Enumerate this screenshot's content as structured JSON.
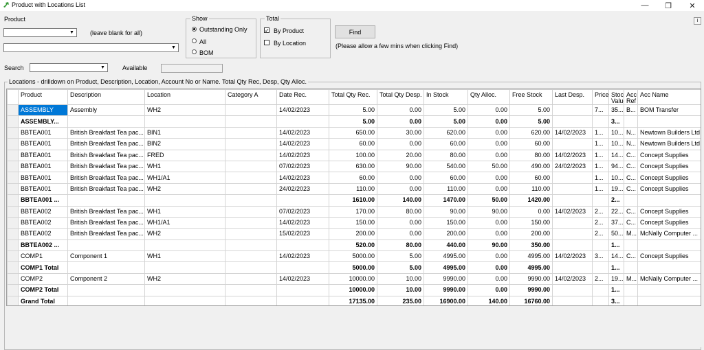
{
  "window": {
    "title": "Product with Locations List",
    "minimize": "—",
    "restore": "❐",
    "close": "✕"
  },
  "filters": {
    "product_label": "Product",
    "product_value": "",
    "blank_hint": "(leave blank for all)",
    "second_value": "",
    "search_label": "Search",
    "search_value": "",
    "available_label": "Available",
    "available_value": ""
  },
  "show": {
    "title": "Show",
    "options": [
      "Outstanding Only",
      "All",
      "BOM"
    ],
    "selected": "Outstanding Only"
  },
  "total": {
    "title": "Total",
    "by_product": "By Product",
    "by_product_checked": true,
    "by_location": "By Location",
    "by_location_checked": false
  },
  "find": {
    "label": "Find",
    "hint": "(Please allow a few mins when clicking Find)"
  },
  "help_label": "i",
  "locations_caption": "Locations - drilldown on Product, Description, Location, Account No or Name. Total Qty Rec, Desp, Qty Alloc.",
  "grid": {
    "columns": [
      "Product",
      "Description",
      "Location",
      "Category A",
      "Date Rec.",
      "Total Qty Rec.",
      "Total Qty Desp.",
      "In Stock",
      "Qty Alloc.",
      "Free Stock",
      "Last Desp.",
      "Price",
      "Stock Value",
      "Acc Ref",
      "Acc Name"
    ],
    "rows": [
      {
        "total": false,
        "cells": [
          "ASSEMBLY",
          "Assembly",
          "WH2",
          "",
          "14/02/2023",
          "5.00",
          "0.00",
          "5.00",
          "0.00",
          "5.00",
          "",
          "7...",
          "35...",
          "B...",
          "BOM Transfer"
        ]
      },
      {
        "total": true,
        "cells": [
          "ASSEMBLY...",
          "",
          "",
          "",
          "",
          "5.00",
          "0.00",
          "5.00",
          "0.00",
          "5.00",
          "",
          "",
          "3...",
          "",
          ""
        ]
      },
      {
        "total": false,
        "cells": [
          "BBTEA001",
          "British Breakfast  Tea pac...",
          "BIN1",
          "",
          "14/02/2023",
          "650.00",
          "30.00",
          "620.00",
          "0.00",
          "620.00",
          "14/02/2023",
          "1...",
          "10...",
          "N...",
          "Newtown Builders Ltd"
        ]
      },
      {
        "total": false,
        "cells": [
          "BBTEA001",
          "British Breakfast  Tea pac...",
          "BIN2",
          "",
          "14/02/2023",
          "60.00",
          "0.00",
          "60.00",
          "0.00",
          "60.00",
          "",
          "1...",
          "10...",
          "N...",
          "Newtown Builders Ltd"
        ]
      },
      {
        "total": false,
        "cells": [
          "BBTEA001",
          "British Breakfast  Tea pac...",
          "FRED",
          "",
          "14/02/2023",
          "100.00",
          "20.00",
          "80.00",
          "0.00",
          "80.00",
          "14/02/2023",
          "1...",
          "14...",
          "C...",
          "Concept Supplies"
        ]
      },
      {
        "total": false,
        "cells": [
          "BBTEA001",
          "British Breakfast  Tea pac...",
          "WH1",
          "",
          "07/02/2023",
          "630.00",
          "90.00",
          "540.00",
          "50.00",
          "490.00",
          "24/02/2023",
          "1...",
          "94...",
          "C...",
          "Concept Supplies"
        ]
      },
      {
        "total": false,
        "cells": [
          "BBTEA001",
          "British Breakfast  Tea pac...",
          "WH1/A1",
          "",
          "14/02/2023",
          "60.00",
          "0.00",
          "60.00",
          "0.00",
          "60.00",
          "",
          "1...",
          "10...",
          "C...",
          "Concept Supplies"
        ]
      },
      {
        "total": false,
        "cells": [
          "BBTEA001",
          "British Breakfast  Tea pac...",
          "WH2",
          "",
          "24/02/2023",
          "110.00",
          "0.00",
          "110.00",
          "0.00",
          "110.00",
          "",
          "1...",
          "19...",
          "C...",
          "Concept Supplies"
        ]
      },
      {
        "total": true,
        "cells": [
          "BBTEA001 ...",
          "",
          "",
          "",
          "",
          "1610.00",
          "140.00",
          "1470.00",
          "50.00",
          "1420.00",
          "",
          "",
          "2...",
          "",
          ""
        ]
      },
      {
        "total": false,
        "cells": [
          "BBTEA002",
          "British Breakfast  Tea pac...",
          "WH1",
          "",
          "07/02/2023",
          "170.00",
          "80.00",
          "90.00",
          "90.00",
          "0.00",
          "14/02/2023",
          "2...",
          "22...",
          "C...",
          "Concept Supplies"
        ]
      },
      {
        "total": false,
        "cells": [
          "BBTEA002",
          "British Breakfast  Tea pac...",
          "WH1/A1",
          "",
          "14/02/2023",
          "150.00",
          "0.00",
          "150.00",
          "0.00",
          "150.00",
          "",
          "2...",
          "37...",
          "C...",
          "Concept Supplies"
        ]
      },
      {
        "total": false,
        "cells": [
          "BBTEA002",
          "British Breakfast  Tea pac...",
          "WH2",
          "",
          "15/02/2023",
          "200.00",
          "0.00",
          "200.00",
          "0.00",
          "200.00",
          "",
          "2...",
          "50...",
          "M...",
          "McNally Computer ..."
        ]
      },
      {
        "total": true,
        "cells": [
          "BBTEA002 ...",
          "",
          "",
          "",
          "",
          "520.00",
          "80.00",
          "440.00",
          "90.00",
          "350.00",
          "",
          "",
          "1...",
          "",
          ""
        ]
      },
      {
        "total": false,
        "cells": [
          "COMP1",
          "Component 1",
          "WH1",
          "",
          "14/02/2023",
          "5000.00",
          "5.00",
          "4995.00",
          "0.00",
          "4995.00",
          "14/02/2023",
          "3...",
          "14...",
          "C...",
          "Concept Supplies"
        ]
      },
      {
        "total": true,
        "cells": [
          "COMP1 Total",
          "",
          "",
          "",
          "",
          "5000.00",
          "5.00",
          "4995.00",
          "0.00",
          "4995.00",
          "",
          "",
          "1...",
          "",
          ""
        ]
      },
      {
        "total": false,
        "cells": [
          "COMP2",
          "Component 2",
          "WH2",
          "",
          "14/02/2023",
          "10000.00",
          "10.00",
          "9990.00",
          "0.00",
          "9990.00",
          "14/02/2023",
          "2...",
          "19...",
          "M...",
          "McNally Computer ..."
        ]
      },
      {
        "total": true,
        "cells": [
          "COMP2 Total",
          "",
          "",
          "",
          "",
          "10000.00",
          "10.00",
          "9990.00",
          "0.00",
          "9990.00",
          "",
          "",
          "1...",
          "",
          ""
        ]
      },
      {
        "total": true,
        "cells": [
          "Grand Total",
          "",
          "",
          "",
          "",
          "17135.00",
          "235.00",
          "16900.00",
          "140.00",
          "16760.00",
          "",
          "",
          "3...",
          "",
          ""
        ]
      }
    ]
  }
}
